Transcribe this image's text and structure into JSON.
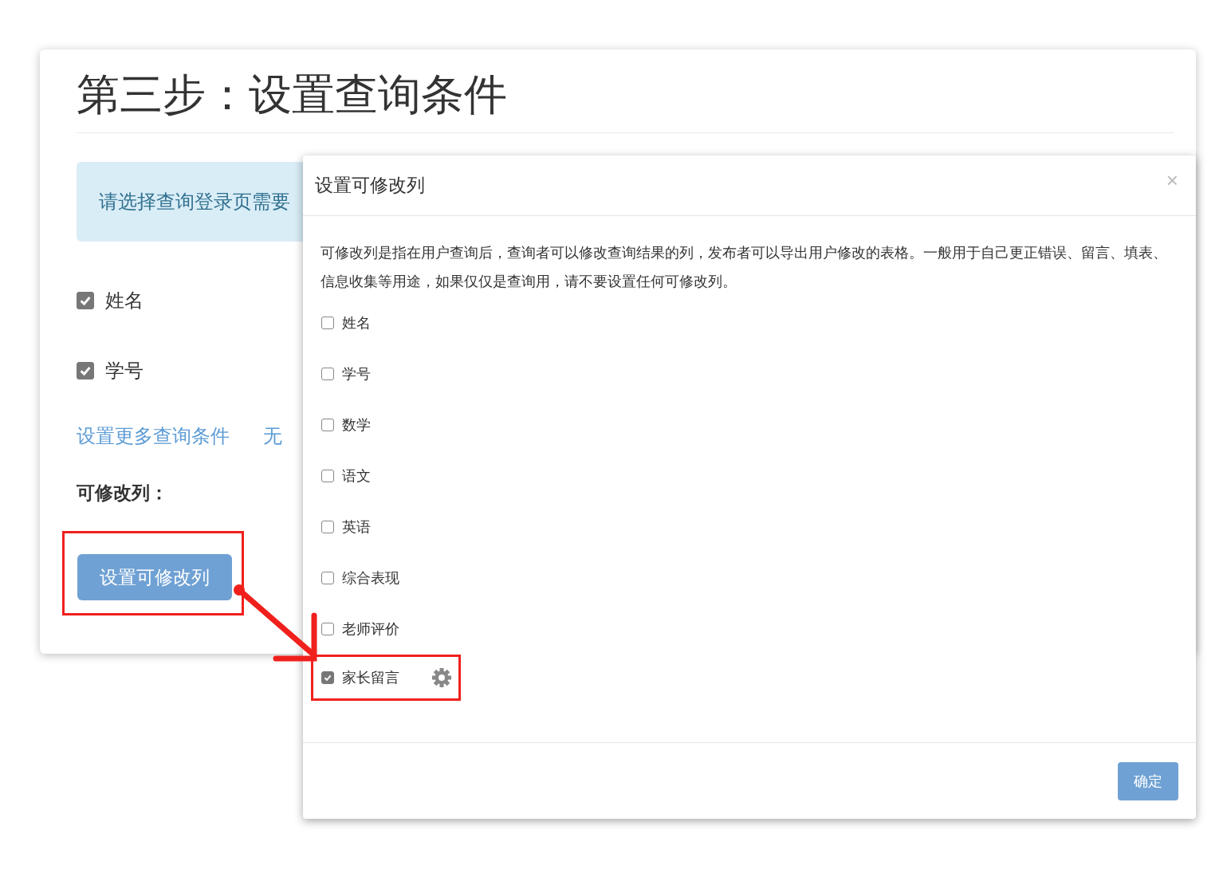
{
  "page": {
    "title": "第三步：设置查询条件",
    "alert": "请选择查询登录页需要",
    "conditions": [
      {
        "label": "姓名",
        "checked": true
      },
      {
        "label": "学号",
        "checked": true
      }
    ],
    "links": [
      "设置更多查询条件",
      "无"
    ],
    "editable_label": "可修改列：",
    "editable_button": {
      "label": "设置可修改列",
      "highlighted": true
    }
  },
  "modal": {
    "title": "设置可修改列",
    "close": "×",
    "description": "可修改列是指在用户查询后，查询者可以修改查询结果的列，发布者可以导出用户修改的表格。一般用于自己更正错误、留言、填表、信息收集等用途，如果仅仅是查询用，请不要设置任何可修改列。",
    "columns": [
      {
        "label": "姓名",
        "checked": false,
        "highlighted": false
      },
      {
        "label": "学号",
        "checked": false,
        "highlighted": false
      },
      {
        "label": "数学",
        "checked": false,
        "highlighted": false
      },
      {
        "label": "语文",
        "checked": false,
        "highlighted": false
      },
      {
        "label": "英语",
        "checked": false,
        "highlighted": false
      },
      {
        "label": "综合表现",
        "checked": false,
        "highlighted": false
      },
      {
        "label": "老师评价",
        "checked": false,
        "highlighted": false
      },
      {
        "label": "家长留言",
        "checked": true,
        "highlighted": true
      }
    ],
    "confirm": "确定"
  }
}
